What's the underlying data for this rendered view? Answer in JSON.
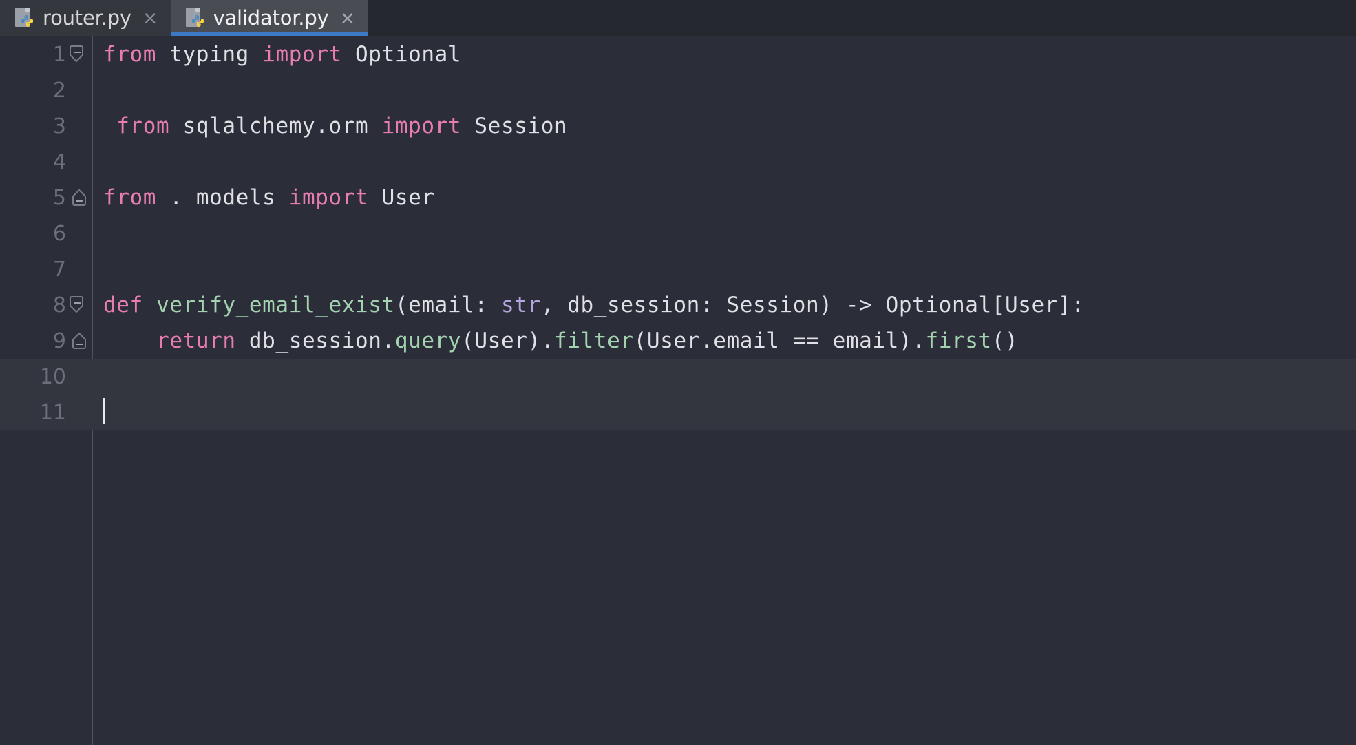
{
  "window": {
    "background": "#2b2d38",
    "title": "validator.py"
  },
  "tabbar": {
    "background": "#26282f",
    "active_underline_color": "#3d7ac5",
    "tabs": [
      {
        "label": "router.py",
        "icon": "python-file-icon",
        "close_glyph": "×",
        "active": false
      },
      {
        "label": "validator.py",
        "icon": "python-file-icon",
        "close_glyph": "×",
        "active": true
      }
    ]
  },
  "editor": {
    "language": "Python",
    "caret_line": 11,
    "caret_column": 1,
    "highlighted_lines": [
      10,
      11
    ],
    "colors": {
      "background": "#2b2d38",
      "line_highlight": "#34363f",
      "line_number": "#6b6f79",
      "text": "#dfe1e5",
      "keyword": "#e87db0",
      "function": "#a3d3b0",
      "type": "#b3a6de",
      "fold_guide": "#50535e"
    },
    "lines": [
      {
        "number": "1",
        "fold": "collapse-down",
        "tokens": [
          {
            "t": "from",
            "c": "kw"
          },
          {
            "t": " ",
            "c": "op"
          },
          {
            "t": "typing",
            "c": "id"
          },
          {
            "t": " ",
            "c": "op"
          },
          {
            "t": "import",
            "c": "kw"
          },
          {
            "t": " ",
            "c": "op"
          },
          {
            "t": "Optional",
            "c": "id"
          }
        ]
      },
      {
        "number": "2",
        "fold": "none",
        "tokens": []
      },
      {
        "number": "3",
        "fold": "none",
        "tokens": [
          {
            "t": " ",
            "c": "op"
          },
          {
            "t": "from",
            "c": "kw"
          },
          {
            "t": " ",
            "c": "op"
          },
          {
            "t": "sqlalchemy.orm",
            "c": "id"
          },
          {
            "t": " ",
            "c": "op"
          },
          {
            "t": "import",
            "c": "kw"
          },
          {
            "t": " ",
            "c": "op"
          },
          {
            "t": "Session",
            "c": "id"
          }
        ]
      },
      {
        "number": "4",
        "fold": "none",
        "tokens": []
      },
      {
        "number": "5",
        "fold": "collapse-up",
        "tokens": [
          {
            "t": "from",
            "c": "kw"
          },
          {
            "t": " . ",
            "c": "op"
          },
          {
            "t": "models",
            "c": "id"
          },
          {
            "t": " ",
            "c": "op"
          },
          {
            "t": "import",
            "c": "kw"
          },
          {
            "t": " ",
            "c": "op"
          },
          {
            "t": "User",
            "c": "id"
          }
        ]
      },
      {
        "number": "6",
        "fold": "none",
        "tokens": []
      },
      {
        "number": "7",
        "fold": "none",
        "tokens": []
      },
      {
        "number": "8",
        "fold": "collapse-down",
        "tokens": [
          {
            "t": "def",
            "c": "kw"
          },
          {
            "t": " ",
            "c": "op"
          },
          {
            "t": "verify_email_exist",
            "c": "fn"
          },
          {
            "t": "(",
            "c": "op"
          },
          {
            "t": "email",
            "c": "id"
          },
          {
            "t": ": ",
            "c": "op"
          },
          {
            "t": "str",
            "c": "typ"
          },
          {
            "t": ", ",
            "c": "op"
          },
          {
            "t": "db_session",
            "c": "id"
          },
          {
            "t": ": ",
            "c": "op"
          },
          {
            "t": "Session",
            "c": "id"
          },
          {
            "t": ") -> ",
            "c": "op"
          },
          {
            "t": "Optional",
            "c": "id"
          },
          {
            "t": "[",
            "c": "op"
          },
          {
            "t": "User",
            "c": "id"
          },
          {
            "t": "]:",
            "c": "op"
          }
        ]
      },
      {
        "number": "9",
        "fold": "collapse-up",
        "tokens": [
          {
            "t": "    ",
            "c": "op"
          },
          {
            "t": "return",
            "c": "kw"
          },
          {
            "t": " ",
            "c": "op"
          },
          {
            "t": "db_session",
            "c": "id"
          },
          {
            "t": ".",
            "c": "op"
          },
          {
            "t": "query",
            "c": "mth"
          },
          {
            "t": "(",
            "c": "op"
          },
          {
            "t": "User",
            "c": "id"
          },
          {
            "t": ").",
            "c": "op"
          },
          {
            "t": "filter",
            "c": "mth"
          },
          {
            "t": "(",
            "c": "op"
          },
          {
            "t": "User",
            "c": "id"
          },
          {
            "t": ".",
            "c": "op"
          },
          {
            "t": "email",
            "c": "id"
          },
          {
            "t": " == ",
            "c": "op"
          },
          {
            "t": "email",
            "c": "id"
          },
          {
            "t": ").",
            "c": "op"
          },
          {
            "t": "first",
            "c": "mth"
          },
          {
            "t": "()",
            "c": "op"
          }
        ]
      },
      {
        "number": "10",
        "fold": "none",
        "tokens": [],
        "highlight": true
      },
      {
        "number": "11",
        "fold": "none",
        "tokens": [],
        "highlight": true,
        "caret": true
      }
    ]
  }
}
